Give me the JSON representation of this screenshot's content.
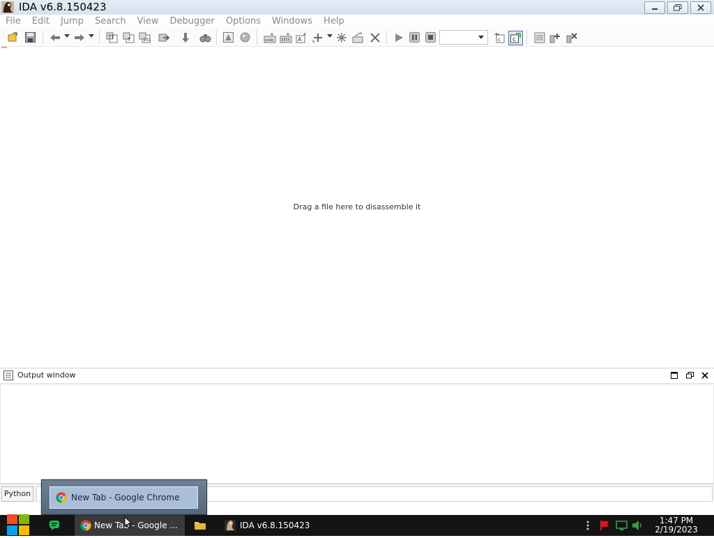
{
  "app": {
    "title": "IDA v6.8.150423",
    "menu": [
      "File",
      "Edit",
      "Jump",
      "Search",
      "View",
      "Debugger",
      "Options",
      "Windows",
      "Help"
    ]
  },
  "workspace": {
    "hint": "Drag a file here to disassemble it"
  },
  "output": {
    "title": "Output window",
    "language_button": "Python"
  },
  "taskbar": {
    "items": [
      {
        "label": "New Tab - Google ...",
        "icon": "chrome-icon",
        "active": true
      },
      {
        "label": "IDA v6.8.150423",
        "icon": "ida-icon",
        "active": false
      }
    ],
    "clock_time": "1:47 PM",
    "clock_date": "2/19/2023"
  },
  "preview": {
    "label": "New Tab - Google Chrome"
  },
  "colors": {
    "taskbar": "#141414",
    "menu_text": "#8a8a8a",
    "preview_bg": "#a9bfd9"
  }
}
